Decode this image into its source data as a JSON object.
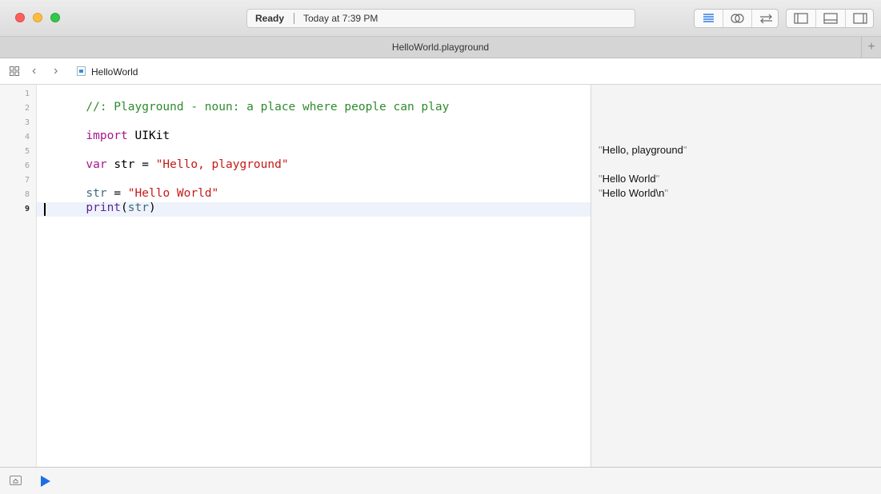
{
  "toolbar": {
    "status": "Ready",
    "time": "Today at 7:39 PM"
  },
  "tab": {
    "title": "HelloWorld.playground",
    "add_label": "+"
  },
  "jumpbar": {
    "back_label": "‹",
    "forward_label": "›",
    "crumb": "HelloWorld"
  },
  "editor": {
    "line_numbers": [
      "1",
      "2",
      "3",
      "4",
      "5",
      "6",
      "7",
      "8",
      "9"
    ],
    "active_line": "9",
    "colors": {
      "comment": "#2e8b2e",
      "keyword": "#a8158a",
      "string": "#c41a16",
      "identifier": "#3b6b7d",
      "plain": "#000000",
      "function": "#5c2699"
    },
    "lines": {
      "l1_comment": "//: Playground - noun: a place where people can play",
      "l3_keyword": "import",
      "l3_module": " UIKit",
      "l5_keyword": "var",
      "l5_decl": " str = ",
      "l5_string": "\"Hello, playground\"",
      "l7_ident": "str",
      "l7_eq": " = ",
      "l7_string": "\"Hello World\"",
      "l8_func": "print",
      "l8_open": "(",
      "l8_arg": "str",
      "l8_close": ")"
    }
  },
  "results": {
    "r5_open": "\"",
    "r5_text": "Hello, playground",
    "r5_close": "\"",
    "r7_open": "\"",
    "r7_text": "Hello World",
    "r7_close": "\"",
    "r8_open": "\"",
    "r8_text": "Hello World\\n",
    "r8_close": "\""
  }
}
